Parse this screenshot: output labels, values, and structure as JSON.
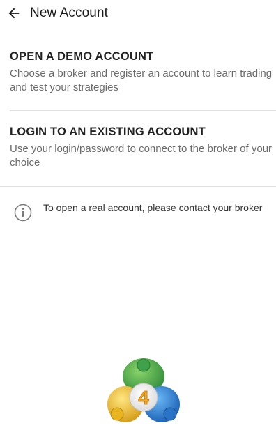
{
  "app_bar": {
    "title": "New Account",
    "back_icon": "arrow-left-icon"
  },
  "options": [
    {
      "title": "OPEN A DEMO ACCOUNT",
      "description": "Choose a broker and register an account to learn trading and test your strategies"
    },
    {
      "title": "LOGIN TO AN EXISTING ACCOUNT",
      "description": "Use your login/password to connect to the broker of your choice"
    }
  ],
  "info": {
    "icon": "info-circle-icon",
    "text": "To open a real account, please contact your broker"
  },
  "logo": {
    "badge_number": "4",
    "colors": {
      "green": "#4caf50",
      "blue": "#1e88e5",
      "yellow": "#f4c430",
      "badge": "#f5a623"
    }
  }
}
